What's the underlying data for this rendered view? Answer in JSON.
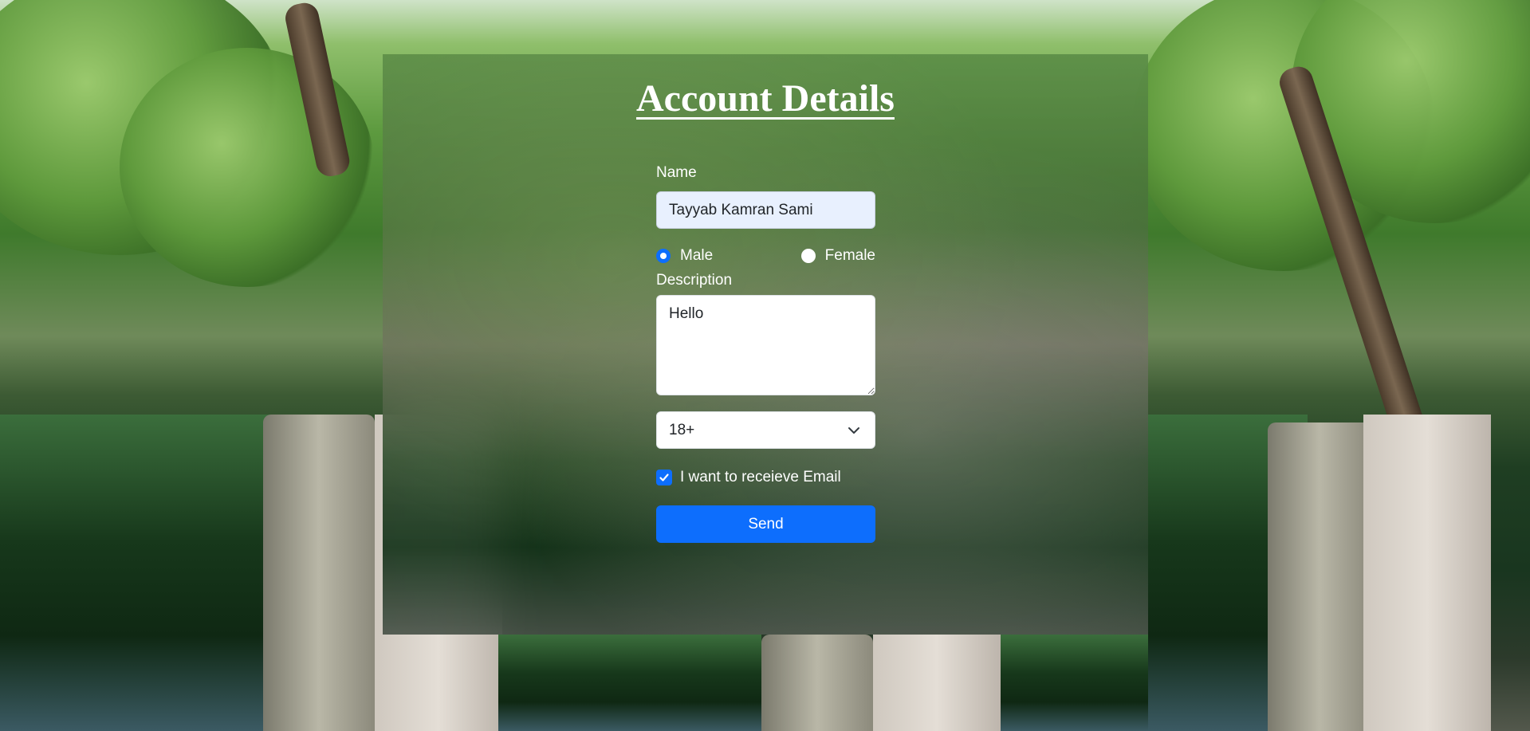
{
  "page": {
    "title": "Account Details"
  },
  "form": {
    "name_label": "Name",
    "name_value": "Tayyab Kamran Sami",
    "gender": {
      "options": [
        "Male",
        "Female"
      ],
      "selected": "Male"
    },
    "description_label": "Description",
    "description_value": "Hello",
    "age_select": {
      "selected": "18+"
    },
    "email_opt_in": {
      "label": "I want to receieve Email",
      "checked": true
    },
    "send_label": "Send"
  },
  "colors": {
    "accent": "#0d6efd",
    "text_on_panel": "#ffffff",
    "input_autofill_bg": "#e8f0fe"
  },
  "icons": {
    "select": "chevron-down-icon",
    "checkbox": "checkmark-icon"
  }
}
